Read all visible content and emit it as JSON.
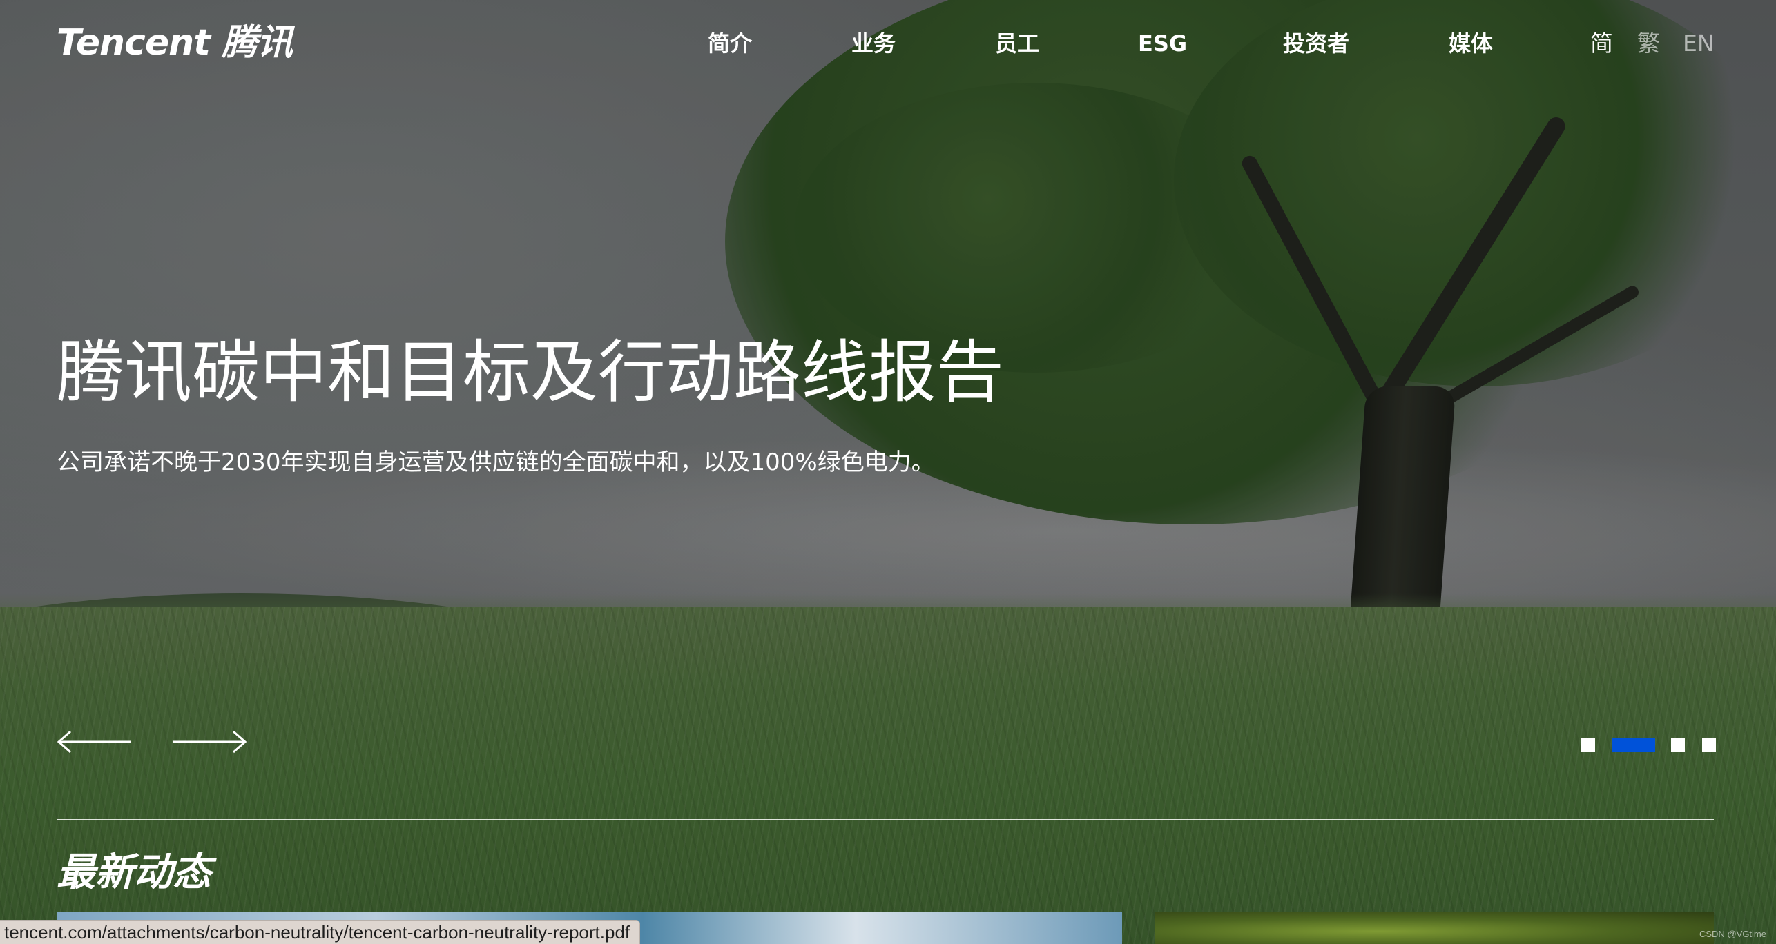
{
  "header": {
    "logo_text": "Tencent 腾讯",
    "nav": [
      "简介",
      "业务",
      "员工",
      "ESG",
      "投资者",
      "媒体"
    ],
    "languages": [
      {
        "label": "简",
        "active": true
      },
      {
        "label": "繁",
        "active": false
      },
      {
        "label": "EN",
        "active": false
      }
    ]
  },
  "hero": {
    "title": "腾讯碳中和目标及行动路线报告",
    "subtitle": "公司承诺不晚于2030年实现自身运营及供应链的全面碳中和，以及100%绿色电力。",
    "prev_icon": "arrow-left-icon",
    "next_icon": "arrow-right-icon",
    "slides_total": 4,
    "active_slide": 2,
    "accent_color": "#0052d9"
  },
  "news": {
    "section_title": "最新动态"
  },
  "status_bar": {
    "url": "tencent.com/attachments/carbon-neutrality/tencent-carbon-neutrality-report.pdf"
  },
  "watermark": "CSDN @VGtime"
}
